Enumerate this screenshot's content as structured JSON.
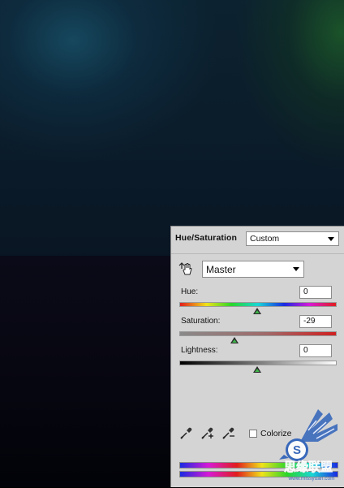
{
  "canvas": {
    "background_colors": {
      "teal_glow": "#19556e",
      "green_glow": "#1e5f28",
      "base_dark": "#070d18"
    }
  },
  "adjustments_panel": {
    "title": "Hue/Saturation",
    "preset": {
      "selected": "Custom"
    },
    "channel": {
      "selected": "Master"
    },
    "hue": {
      "label": "Hue:",
      "value": "0",
      "slider_fraction": 0.5
    },
    "saturation": {
      "label": "Saturation:",
      "value": "-29",
      "slider_fraction": 0.355
    },
    "lightness": {
      "label": "Lightness:",
      "value": "0",
      "slider_fraction": 0.5
    },
    "colorize": {
      "label": "Colorize",
      "checked": false
    },
    "icons": [
      "on-image-adjust-icon",
      "eyedropper-icon",
      "eyedropper-plus-icon",
      "eyedropper-minus-icon"
    ]
  },
  "watermark": {
    "text_lines": [
      "思缘联盟",
      "www.missyuan.com"
    ],
    "icon": "winged-s-logo-icon",
    "color": "#2b5fb8"
  }
}
